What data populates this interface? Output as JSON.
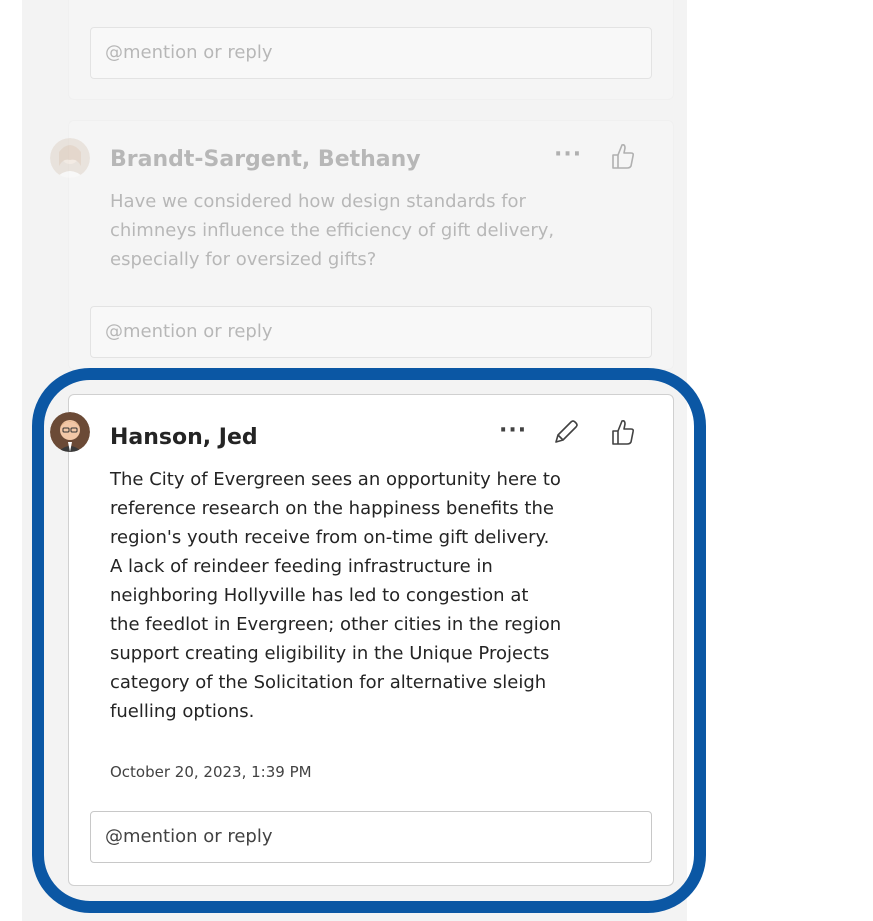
{
  "threads": [
    {
      "reply_placeholder": "@mention or reply"
    },
    {
      "author": "Brandt-Sargent, Bethany",
      "body_lines": [
        "Have we considered how design standards for",
        "chimneys influence the efficiency of gift delivery,",
        "especially for oversized gifts?"
      ],
      "reply_placeholder": "@mention or reply",
      "more_label": "···"
    },
    {
      "author": "Hanson, Jed",
      "body_lines": [
        "The City of Evergreen sees an opportunity here to",
        "reference research on the happiness benefits the",
        "region's youth receive from on-time gift delivery.",
        "A lack of reindeer feeding infrastructure in",
        "neighboring Hollyville has led to congestion at",
        "the feedlot in Evergreen; other cities in the region",
        "support creating eligibility in the Unique Projects",
        "category of the Solicitation for alternative sleigh",
        "fuelling options."
      ],
      "timestamp": "October 20, 2023, 1:39 PM",
      "reply_placeholder": "@mention or reply",
      "more_label": "···"
    }
  ],
  "icons": {
    "more": "more-options-icon",
    "edit": "pencil-icon",
    "like": "thumbs-up-icon"
  },
  "colors": {
    "highlight_border": "#0b57a4",
    "pane_background": "#f3f3f3"
  }
}
